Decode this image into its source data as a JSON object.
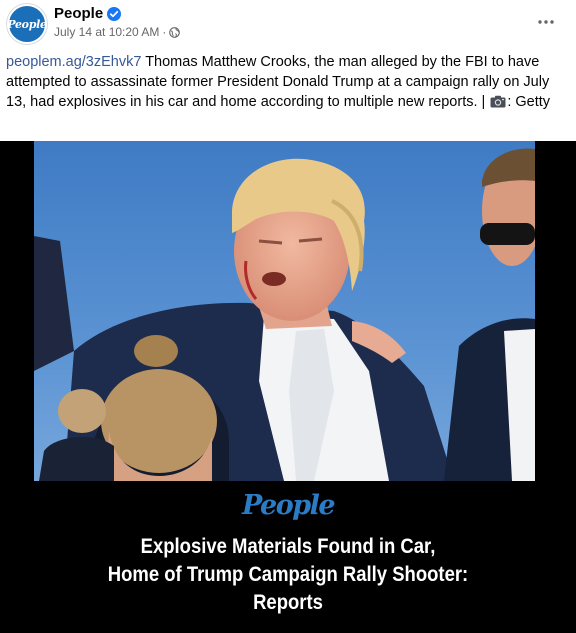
{
  "post": {
    "page_name": "People",
    "avatar_text": "People",
    "timestamp": "July 14 at 10:20 AM",
    "separator": "·",
    "caption_link": "peoplem.ag/3zEhvk7",
    "caption_text": " Thomas Matthew Crooks, the man alleged by the FBI to have attempted to assassinate former President Donald Trump at a campaign rally on July 13, had explosives in his car and home according to multiple new reports. | ",
    "caption_tail": ": Getty"
  },
  "media": {
    "brand": "People",
    "headline_lines": [
      "Explosive Materials Found in Car,",
      "Home of Trump Campaign Rally Shooter:",
      "Reports"
    ]
  },
  "icons": {
    "verified": "verified-badge-icon",
    "privacy": "globe-icon",
    "more": "more-options-icon",
    "camera": "camera-icon"
  },
  "colors": {
    "link": "#385898",
    "brand_blue": "#2a7cc7",
    "verified_blue": "#1877f2",
    "meta_gray": "#65676b"
  }
}
